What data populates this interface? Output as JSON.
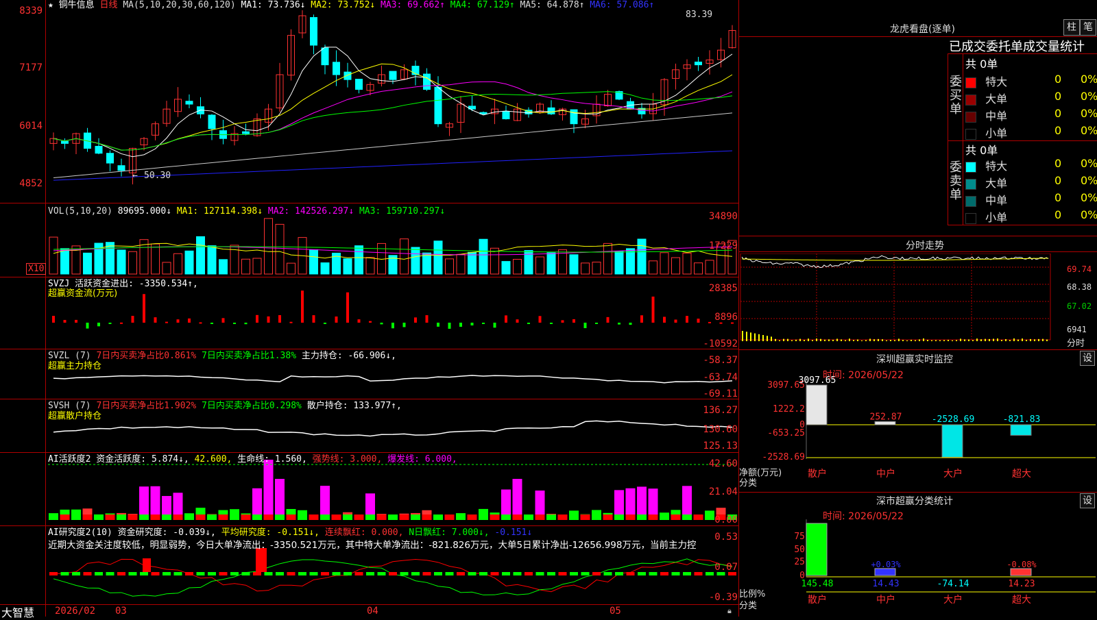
{
  "stock": {
    "name": "铜牛信息",
    "period": "日线"
  },
  "main_panel": {
    "ma_header": "MA(5,10,20,30,60,120)",
    "ma1": "MA1: 73.736↓",
    "ma2": "MA2: 73.752↓",
    "ma3": "MA3: 69.662↑",
    "ma4": "MA4: 67.129↑",
    "ma5": "MA5: 64.878↑",
    "ma6": "MA6: 57.086↑",
    "y_labels": [
      "8339",
      "7177",
      "6014",
      "4852"
    ],
    "high_marker": "83.39",
    "low_marker": "50.30"
  },
  "vol_panel": {
    "header": "VOL(5,10,20)",
    "vol": "89695.000↓",
    "ma1": "MA1: 127114.398↓",
    "ma2": "MA2: 142526.297↓",
    "ma3": "MA3: 159710.297↓",
    "y_labels": [
      "34890",
      "17229"
    ],
    "unit": "X10"
  },
  "svzj_panel": {
    "header": "SVZJ  活跃资金进出: -3350.534↑,",
    "subtitle": "超赢资金流(万元)",
    "y_labels": [
      "28385",
      "8896",
      "-10592"
    ]
  },
  "svzl_panel": {
    "header_a": "SVZL (7)",
    "header_b": "7日内买卖净占比0.861%",
    "header_c": "7日内买卖净占比1.38%",
    "header_d": "主力持仓: -66.906↓,",
    "subtitle": "超赢主力持仓",
    "y_labels": [
      "-58.37",
      "-63.74",
      "-69.11"
    ]
  },
  "svsh_panel": {
    "header_a": "SVSH (7)",
    "header_b": "7日内买卖净占比1.902%",
    "header_c": "7日内买卖净占比0.298%",
    "header_d": "散户持仓: 133.977↑,",
    "subtitle": "超赢散户持仓",
    "y_labels": [
      "136.27",
      "130.60",
      "125.13"
    ]
  },
  "ai_active_panel": {
    "header_a": "AI活跃度2 资金活跃度: 5.874↓,",
    "header_b": "42.600,",
    "header_c": "生命线: 1.560,",
    "header_d": "强势线: 3.000,",
    "header_e": "爆发线: 6.000,",
    "y_labels": [
      "42.60",
      "21.04",
      "0.00"
    ]
  },
  "ai_research_panel": {
    "header_a": "AI研究度2(10) 资金研究度: -0.039↓,",
    "header_b": "平均研究度: -0.151↓,",
    "header_c": "连续飘红: 0.000,",
    "header_d": "N日飘红: 7.000↓,",
    "header_e": "-0.151↓",
    "comment": "近期大资金关注度较低，明显弱势，今日大单净流出：-3350.521万元，其中特大单净流出：-821.826万元，大单5日累计净出-12656.998万元，当前主力控",
    "y_labels": [
      "0.53",
      "0.07",
      "-0.39"
    ]
  },
  "timeline": {
    "brand": "大智慧",
    "labels": [
      "2026/02",
      "03",
      "04",
      "05"
    ]
  },
  "longhu": {
    "title": "龙虎看盘(逐单)",
    "btn1": "柱",
    "btn2": "笔",
    "subtitle": "已成交委托单成交量统计",
    "buy_side": "委买单",
    "sell_side": "委卖单",
    "buy_total": "共 0单",
    "sell_total": "共 0单",
    "buy_rows": [
      {
        "label": "特大",
        "count": "0",
        "pct": "0%",
        "color": "#ff0000"
      },
      {
        "label": "大单",
        "count": "0",
        "pct": "0%",
        "color": "#990000"
      },
      {
        "label": "中单",
        "count": "0",
        "pct": "0%",
        "color": "#660000"
      },
      {
        "label": "小单",
        "count": "0",
        "pct": "0%",
        "color": "#000000"
      }
    ],
    "sell_rows": [
      {
        "label": "特大",
        "count": "0",
        "pct": "0%",
        "color": "#00ffff"
      },
      {
        "label": "大单",
        "count": "0",
        "pct": "0%",
        "color": "#008b8b"
      },
      {
        "label": "中单",
        "count": "0",
        "pct": "0%",
        "color": "#006b6b"
      },
      {
        "label": "小单",
        "count": "0",
        "pct": "0%",
        "color": "#000000"
      }
    ]
  },
  "intraday": {
    "title": "分时走势",
    "y_labels": [
      "69.74",
      "68.38",
      "67.02",
      "6941"
    ],
    "bottom_label": "分时"
  },
  "sz_monitor": {
    "title": "深圳超赢实时监控",
    "btn": "设",
    "time": "时间: 2026/05/22",
    "y_labels": [
      "3097.65",
      "1222.2",
      "0",
      "-653.25",
      "-2528.69"
    ],
    "axis_title": "净额(万元)",
    "axis_sub": "分类",
    "categories": [
      "散户",
      "中户",
      "大户",
      "超大"
    ],
    "values": [
      3097.65,
      252.87,
      -2528.69,
      -821.83
    ],
    "value_labels": [
      "3097.65",
      "252.87",
      "-2528.69",
      "-821.83"
    ]
  },
  "sz_classify": {
    "title": "深市超赢分类统计",
    "btn": "设",
    "time": "时间: 2026/05/22",
    "y_labels": [
      "75",
      "50",
      "25",
      "0"
    ],
    "axis_title": "比例%",
    "axis_sub": "分类",
    "categories": [
      "散户",
      "中户",
      "大户",
      "超大"
    ],
    "values": [
      145.48,
      14.43,
      -74.14,
      14.23
    ],
    "pct_labels": [
      "",
      "+0.03%",
      "",
      "-0.08%"
    ],
    "value_labels": [
      "145.48",
      "14.43",
      "-74.14",
      "14.23"
    ]
  }
}
